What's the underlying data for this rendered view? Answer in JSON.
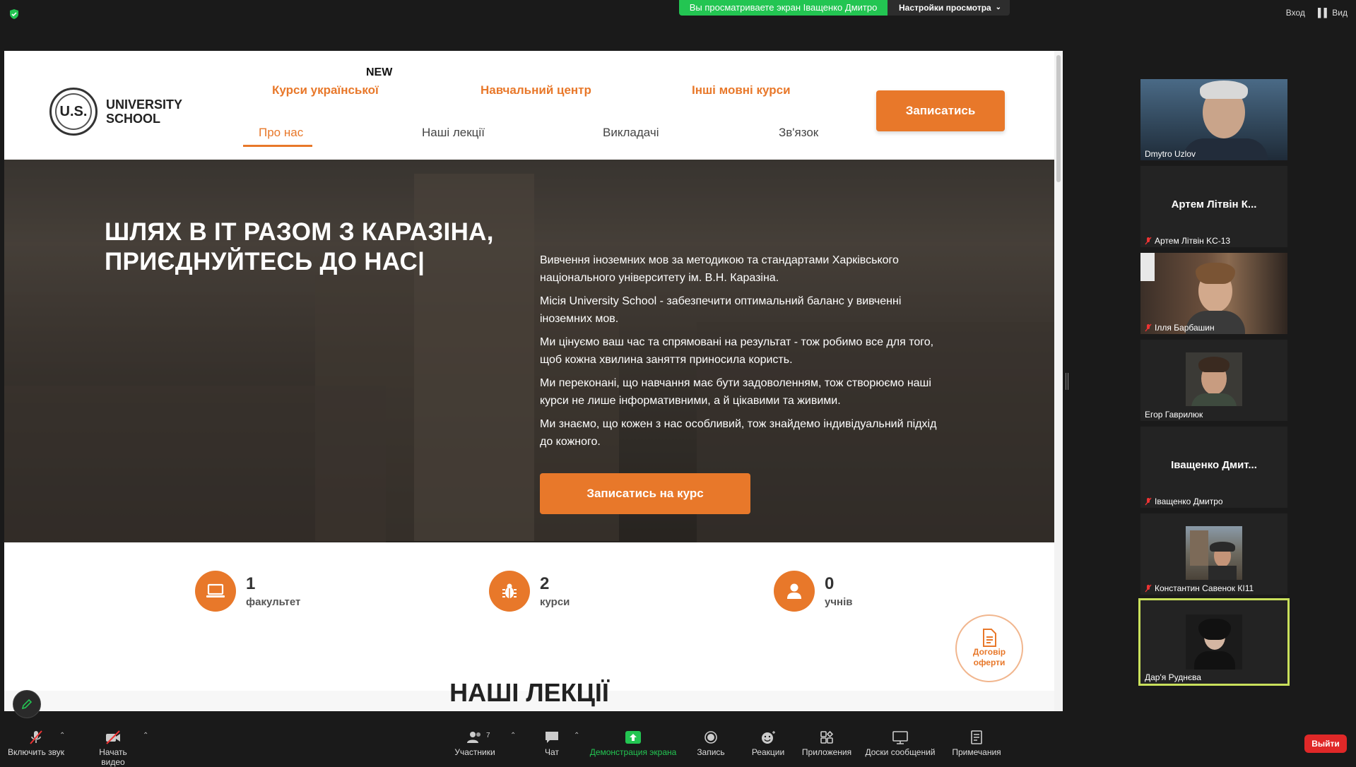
{
  "zoom": {
    "share_banner": "Вы просматриваете экран Іващенко Дмитро",
    "view_settings": "Настройки просмотра",
    "top_right": {
      "login": "Вход",
      "view": "Вид"
    },
    "toolbar": {
      "unmute": "Включить звук",
      "start_video": "Начать видео",
      "participants": "Участники",
      "participants_count": "7",
      "chat": "Чат",
      "share_screen": "Демонстрация экрана",
      "record": "Запись",
      "reactions": "Реакции",
      "apps": "Приложения",
      "whiteboards": "Доски сообщений",
      "notes": "Примечания",
      "leave": "Выйти"
    },
    "participants": [
      {
        "name": "Dmytro Uzlov",
        "video": true,
        "muted": false
      },
      {
        "name": "Артем Літвін KC-13",
        "display": "Артем Літвін К...",
        "video": false,
        "muted": true
      },
      {
        "name": "Ілля Барбашин",
        "video": true,
        "muted": true
      },
      {
        "name": "Егор Гаврилюк",
        "video": false,
        "avatar": true,
        "muted": false
      },
      {
        "name": "Іващенко Дмитро",
        "display": "Іващенко Дмит...",
        "video": false,
        "muted": true
      },
      {
        "name": "Константин Савенок КІ11",
        "video": false,
        "avatar": true,
        "muted": true
      },
      {
        "name": "Дар'я Руднєва",
        "video": false,
        "avatar": true,
        "muted": false,
        "active": true
      }
    ],
    "colors": {
      "green": "#23c552",
      "active_border": "#c9e05b",
      "leave": "#e02828"
    }
  },
  "site": {
    "logo": {
      "mark": "U.S.",
      "line1": "UNIVERSITY",
      "line2": "SCHOOL"
    },
    "new_badge": "NEW",
    "nav_top": [
      "Курси української",
      "Навчальний центр",
      "Інші мовні курси"
    ],
    "nav_bottom": [
      "Про нас",
      "Наші лекції",
      "Викладачі",
      "Зв'язок"
    ],
    "signup": "Записатись",
    "hero": {
      "title_line1": "ШЛЯХ В ІТ РАЗОМ З КАРАЗІНА,",
      "title_line2": "ПРИЄДНУЙТЕСЬ ДО НАС|",
      "paragraphs": [
        "Вивчення іноземних мов за методикою та стандартами Харківського національного університету ім. В.Н. Каразіна.",
        "Місія University School - забезпечити оптимальний баланс у вивченні іноземних мов.",
        "Ми цінуємо ваш час та спрямовані на результат - тож робимо все для того, щоб кожна хвилина заняття приносила користь.",
        "Ми переконані, що навчання має бути задоволенням, тож створюємо наші курси не лише інформативними, а й цікавими та живими.",
        "Ми знаємо, що кожен з нас особливий, тож знайдемо індивідуальний підхід до кожного."
      ],
      "cta": "Записатись на курс"
    },
    "stats": [
      {
        "value": "1",
        "label": "факультет",
        "icon": "laptop-icon"
      },
      {
        "value": "2",
        "label": "курси",
        "icon": "bug-icon"
      },
      {
        "value": "0",
        "label": "учнів",
        "icon": "user-icon"
      }
    ],
    "dogovir_line1": "Договір",
    "dogovir_line2": "оферти",
    "lectures_title": "НАШІ ЛЕКЦІЇ",
    "colors": {
      "accent": "#e8782a"
    }
  }
}
